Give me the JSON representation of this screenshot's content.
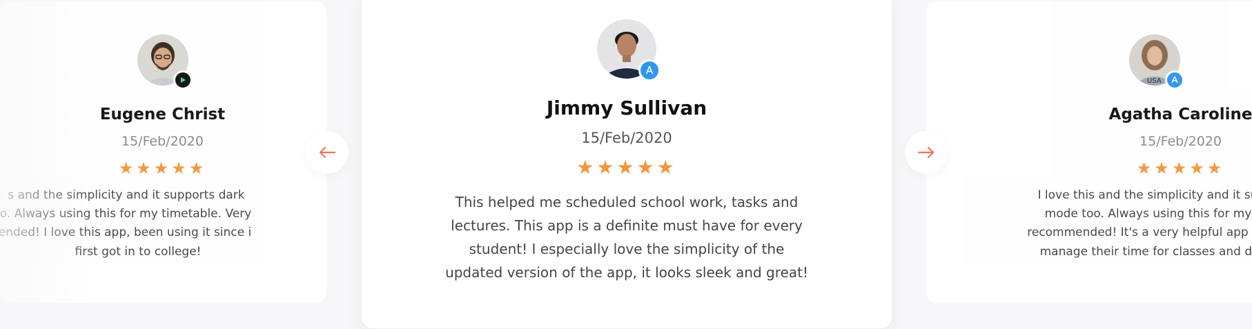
{
  "reviews": [
    {
      "name": "Eugene Christ",
      "date": "15/Feb/2020",
      "rating": 5,
      "store_icon": "google-play-icon",
      "text_lines": [
        "s and the simplicity and it supports dark",
        "o. Always using this for my timetable. Very",
        "ended! I love this app, been using it since i",
        "first got in to college!"
      ]
    },
    {
      "name": "Jimmy Sullivan",
      "date": "15/Feb/2020",
      "rating": 5,
      "store_icon": "app-store-icon",
      "text_lines": [
        "This helped me scheduled school work, tasks and",
        "lectures. This app is a definite must have for every",
        "student! I especially love the simplicity of the",
        "updated version of the app, it looks sleek and great!"
      ]
    },
    {
      "name": "Agatha Caroline",
      "date": "15/Feb/2020",
      "rating": 5,
      "store_icon": "app-store-icon",
      "text_lines": [
        "I love this and the simplicity and it suppo",
        "mode too. Always using this for my timeta",
        "recommended! It's a very helpful app for s",
        "manage their time for classes and do th"
      ]
    }
  ],
  "nav": {
    "prev_icon": "arrow-left-icon",
    "next_icon": "arrow-right-icon"
  },
  "colors": {
    "star": "#f2963b",
    "arrow": "#f0715a",
    "app_store_badge": "#2f95f0",
    "google_play_badge": "#111111"
  }
}
